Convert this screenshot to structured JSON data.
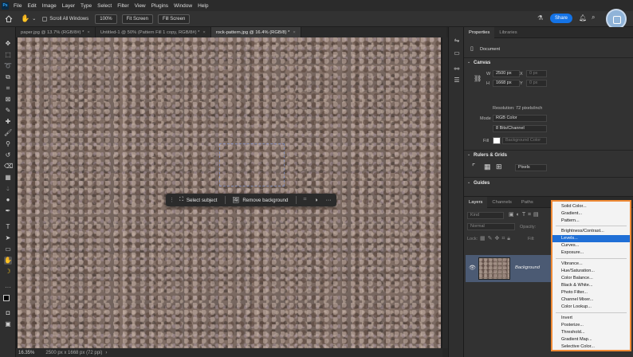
{
  "menubar": {
    "logo": "Ps",
    "items": [
      "File",
      "Edit",
      "Image",
      "Layer",
      "Type",
      "Select",
      "Filter",
      "View",
      "Plugins",
      "Window",
      "Help"
    ]
  },
  "options": {
    "scroll_all_windows": "Scroll All Windows",
    "zoom_100": "100%",
    "fit_screen": "Fit Screen",
    "fill_screen": "Fill Screen",
    "share": "Share"
  },
  "tabs": [
    {
      "label": "paper.jpg @ 13.7% (RGB/8#) *",
      "active": false
    },
    {
      "label": "Untitled-1 @ 50% (Pattern Fill 1 copy, RGB/8#) *",
      "active": false
    },
    {
      "label": "rock-pattern.jpg @ 16.4% (RGB/8) *",
      "active": true
    }
  ],
  "context_bar": {
    "select_subject": "Select subject",
    "remove_background": "Remove background"
  },
  "status": {
    "zoom": "16.35%",
    "dimensions": "2500 px x 1668 px (72 ppi)"
  },
  "properties": {
    "tab_properties": "Properties",
    "tab_libraries": "Libraries",
    "document_label": "Document",
    "canvas_heading": "Canvas",
    "w_label": "W",
    "w_value": "2500 px",
    "h_label": "H",
    "h_value": "1668 px",
    "x_label": "X",
    "x_value": "0 px",
    "y_label": "Y",
    "y_value": "0 px",
    "resolution": "Resolution: 72 pixels/inch",
    "mode_label": "Mode",
    "mode_value": "RGB Color",
    "depth_value": "8 Bits/Channel",
    "fill_label": "Fill",
    "fill_value": "Background Color",
    "rulers_heading": "Rulers & Grids",
    "units_value": "Pixels",
    "guides_heading": "Guides"
  },
  "layers": {
    "tab_layers": "Layers",
    "tab_channels": "Channels",
    "tab_paths": "Paths",
    "kind_placeholder": "Kind",
    "blend_mode": "Normal",
    "opacity_label": "Opacity:",
    "lock_label": "Lock:",
    "fill_label": "Fill:",
    "layer_name": "Background"
  },
  "dropdown": {
    "items": [
      {
        "label": "Solid Color...",
        "selected": false
      },
      {
        "label": "Gradient...",
        "selected": false
      },
      {
        "label": "Pattern...",
        "selected": false
      },
      {
        "label": "Brightness/Contrast...",
        "selected": false
      },
      {
        "label": "Levels...",
        "selected": true
      },
      {
        "label": "Curves...",
        "selected": false
      },
      {
        "label": "Exposure...",
        "selected": false
      },
      {
        "label": "Vibrance...",
        "selected": false
      },
      {
        "label": "Hue/Saturation...",
        "selected": false
      },
      {
        "label": "Color Balance...",
        "selected": false
      },
      {
        "label": "Black & White...",
        "selected": false
      },
      {
        "label": "Photo Filter...",
        "selected": false
      },
      {
        "label": "Channel Mixer...",
        "selected": false
      },
      {
        "label": "Color Lookup...",
        "selected": false
      },
      {
        "label": "Invert",
        "selected": false
      },
      {
        "label": "Posterize...",
        "selected": false
      },
      {
        "label": "Threshold...",
        "selected": false
      },
      {
        "label": "Gradient Map...",
        "selected": false
      },
      {
        "label": "Selective Color...",
        "selected": false
      }
    ]
  },
  "colors": {
    "accent": "#1473e6",
    "menu_border": "#f08a35",
    "selected_item": "#1f6fd6"
  }
}
